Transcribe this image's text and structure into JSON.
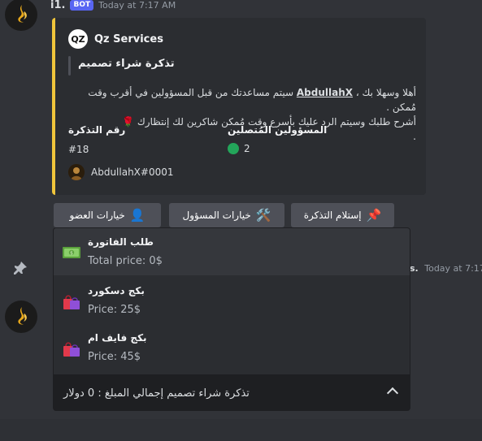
{
  "message": {
    "author_partial": "i1.",
    "bot_tag": "BOT",
    "timestamp": "Today at 7:17 AM"
  },
  "embed": {
    "accent_color": "#f0c53b",
    "author_icon_text": "QZ",
    "author_name": "Qz Services",
    "title": "تذكرة شراء تصميم",
    "description_line1_prefix": "أهلا وسهلا بك ،",
    "description_mention": "AbdullahX",
    "description_line1_suffix": "سيتم مساعدتك من قبل المسؤولين في أقرب وقت مُمكن .",
    "description_line2": "أشرح طلبك وسيتم الرد عليك بأسرع وقت مُمكن شاكرين لك إنتظارك",
    "description_line2_emoji": "🌹",
    "description_line3": ".",
    "fields": [
      {
        "name": "رقم التذكرة",
        "value": "#18"
      },
      {
        "name": "المسؤولين المُتصلين",
        "value": "2"
      }
    ],
    "footer_text": "AbdullahX#0001"
  },
  "buttons": [
    {
      "label": "خيارات العضو",
      "icon": "👤"
    },
    {
      "label": "خيارات المسؤول",
      "icon": "🛠️"
    },
    {
      "label": "إستلام التذكرة",
      "icon": "📌"
    }
  ],
  "system_message": {
    "name_partial": "s.",
    "timestamp": "Today at 7:17"
  },
  "select_menu": {
    "options": [
      {
        "label": "طلب الفاتورة",
        "description": "Total price: 0$",
        "icon": "money-icon"
      },
      {
        "label": "بكج دسكورد",
        "description": "Price: 25$",
        "icon": "shopping-bags-icon"
      },
      {
        "label": "بكج فايف ام",
        "description": "Price: 45$",
        "icon": "shopping-bags-icon"
      }
    ],
    "placeholder": "تذكرة شراء تصميم إجمالي المبلغ : 0 دولار"
  }
}
